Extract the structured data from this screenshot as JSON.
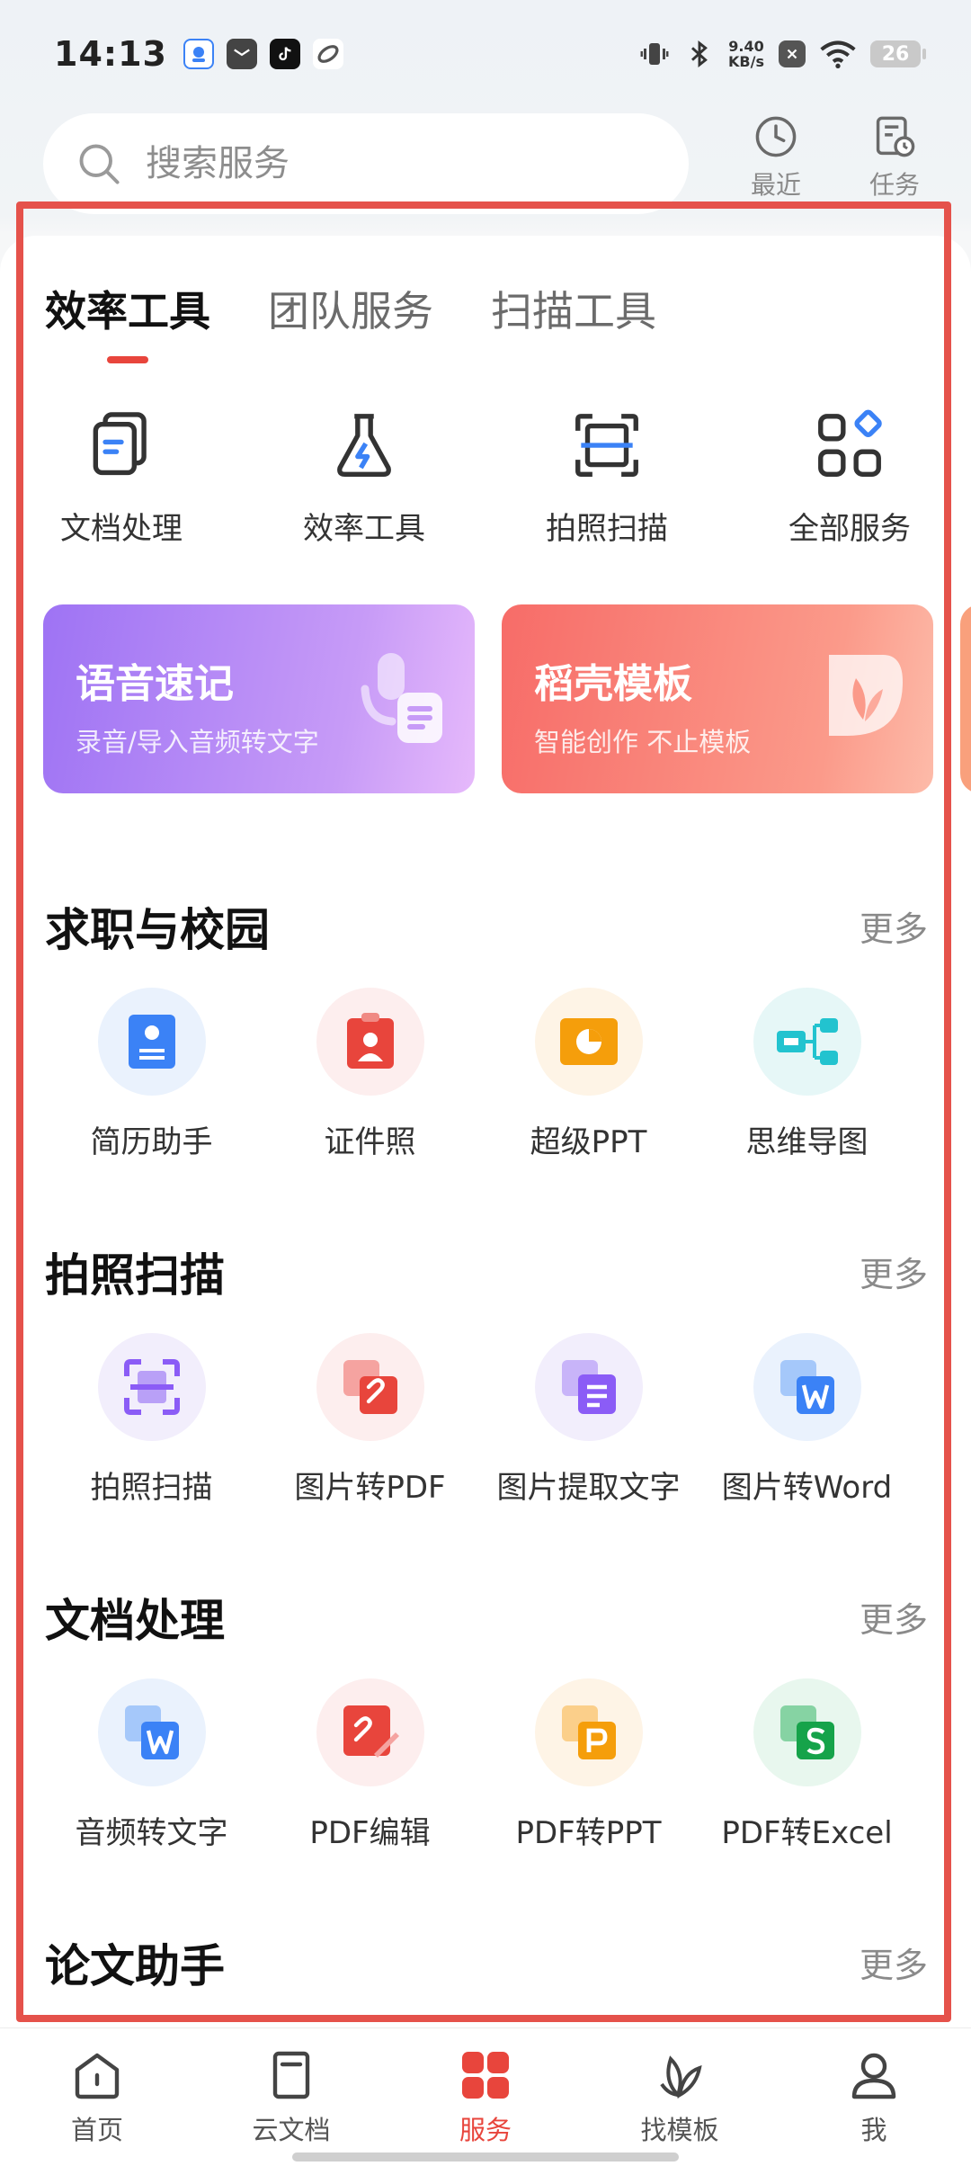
{
  "status_bar": {
    "time": "14:13",
    "net_speed_value": "9.40",
    "net_speed_unit": "KB/s",
    "battery": "26"
  },
  "search": {
    "placeholder": "搜索服务"
  },
  "top_actions": {
    "recent": "最近",
    "tasks": "任务"
  },
  "tabs": [
    {
      "label": "效率工具",
      "active": true
    },
    {
      "label": "团队服务",
      "active": false
    },
    {
      "label": "扫描工具",
      "active": false
    }
  ],
  "quick_tools": [
    {
      "label": "文档处理",
      "icon": "document-stack-icon"
    },
    {
      "label": "效率工具",
      "icon": "flask-lightning-icon"
    },
    {
      "label": "拍照扫描",
      "icon": "scan-frame-icon"
    },
    {
      "label": "全部服务",
      "icon": "grid-diamond-icon"
    }
  ],
  "banners": [
    {
      "title": "语音速记",
      "subtitle": "录音/导入音频转文字",
      "color": "#9e73f4"
    },
    {
      "title": "稻壳模板",
      "subtitle": "智能创作 不止模板",
      "color": "#f76c68"
    }
  ],
  "sections": [
    {
      "title": "求职与校园",
      "more": "更多",
      "items": [
        {
          "label": "简历助手",
          "icon": "resume-icon",
          "bg": "#eaf2fd",
          "color": "#3b82f6"
        },
        {
          "label": "证件照",
          "icon": "id-photo-icon",
          "bg": "#fdeeee",
          "color": "#e8453c"
        },
        {
          "label": "超级PPT",
          "icon": "ppt-icon",
          "bg": "#fef4e6",
          "color": "#f59e0b"
        },
        {
          "label": "思维导图",
          "icon": "mindmap-icon",
          "bg": "#e6f7f7",
          "color": "#22c3cf"
        }
      ]
    },
    {
      "title": "拍照扫描",
      "more": "更多",
      "items": [
        {
          "label": "拍照扫描",
          "icon": "photo-scan-icon",
          "bg": "#f2eefc",
          "color": "#8b5cf6"
        },
        {
          "label": "图片转PDF",
          "icon": "image-to-pdf-icon",
          "bg": "#fdeeee",
          "color": "#e8453c"
        },
        {
          "label": "图片提取文字",
          "icon": "image-ocr-icon",
          "bg": "#f2eefc",
          "color": "#8b5cf6"
        },
        {
          "label": "图片转Word",
          "icon": "image-to-word-icon",
          "bg": "#eaf2fd",
          "color": "#3b82f6"
        }
      ]
    },
    {
      "title": "文档处理",
      "more": "更多",
      "items": [
        {
          "label": "音频转文字",
          "icon": "audio-to-text-icon",
          "bg": "#eaf2fd",
          "color": "#3b82f6"
        },
        {
          "label": "PDF编辑",
          "icon": "pdf-edit-icon",
          "bg": "#fdeeee",
          "color": "#e8453c"
        },
        {
          "label": "PDF转PPT",
          "icon": "pdf-to-ppt-icon",
          "bg": "#fef4e6",
          "color": "#f59e0b"
        },
        {
          "label": "PDF转Excel",
          "icon": "pdf-to-excel-icon",
          "bg": "#e8f7ee",
          "color": "#16a34a"
        }
      ]
    },
    {
      "title": "论文助手",
      "more": "更多",
      "items": []
    }
  ],
  "bottom_nav": [
    {
      "label": "首页",
      "icon": "home-icon",
      "active": false
    },
    {
      "label": "云文档",
      "icon": "cloud-doc-icon",
      "active": false
    },
    {
      "label": "服务",
      "icon": "services-grid-icon",
      "active": true
    },
    {
      "label": "找模板",
      "icon": "leaf-template-icon",
      "active": false
    },
    {
      "label": "我",
      "icon": "person-icon",
      "active": false
    }
  ],
  "colors": {
    "accent": "#e8453c",
    "highlight_frame": "#e5524b"
  }
}
